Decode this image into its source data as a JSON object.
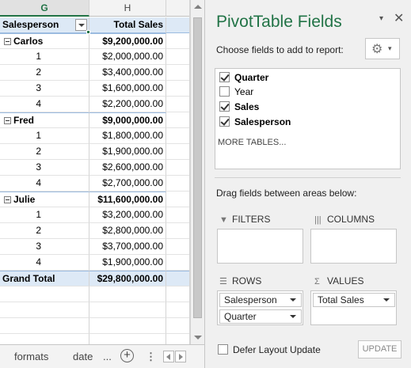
{
  "sheet": {
    "columns": [
      "G",
      "H"
    ],
    "headers": {
      "row_label": "Salesperson",
      "value_label": "Total Sales"
    },
    "groups": [
      {
        "name": "Carlos",
        "total": "$9,200,000.00",
        "items": [
          {
            "label": "1",
            "value": "$2,000,000.00"
          },
          {
            "label": "2",
            "value": "$3,400,000.00"
          },
          {
            "label": "3",
            "value": "$1,600,000.00"
          },
          {
            "label": "4",
            "value": "$2,200,000.00"
          }
        ]
      },
      {
        "name": "Fred",
        "total": "$9,000,000.00",
        "items": [
          {
            "label": "1",
            "value": "$1,800,000.00"
          },
          {
            "label": "2",
            "value": "$1,900,000.00"
          },
          {
            "label": "3",
            "value": "$2,600,000.00"
          },
          {
            "label": "4",
            "value": "$2,700,000.00"
          }
        ]
      },
      {
        "name": "Julie",
        "total": "$11,600,000.00",
        "items": [
          {
            "label": "1",
            "value": "$3,200,000.00"
          },
          {
            "label": "2",
            "value": "$2,800,000.00"
          },
          {
            "label": "3",
            "value": "$3,700,000.00"
          },
          {
            "label": "4",
            "value": "$1,900,000.00"
          }
        ]
      }
    ],
    "grand_total": {
      "label": "Grand Total",
      "value": "$29,800,000.00"
    }
  },
  "tabs": {
    "sheet1": "formats",
    "sheet2": "date",
    "more": "...",
    "add": "+",
    "separator": "⋮"
  },
  "pane": {
    "title": "PivotTable Fields",
    "close": "✕",
    "dropdown": "▾",
    "choose_label": "Choose fields to add to report:",
    "fields": [
      {
        "name": "Quarter",
        "checked": true
      },
      {
        "name": "Year",
        "checked": false
      },
      {
        "name": "Sales",
        "checked": true
      },
      {
        "name": "Salesperson",
        "checked": true
      }
    ],
    "more_tables": "MORE TABLES...",
    "drag_label": "Drag fields between areas below:",
    "areas": {
      "filters": "FILTERS",
      "columns": "COLUMNS",
      "rows": "ROWS",
      "values": "VALUES"
    },
    "rows_fields": [
      "Salesperson",
      "Quarter"
    ],
    "values_fields": [
      "Total Sales"
    ],
    "defer_label": "Defer Layout Update",
    "update_label": "UPDATE"
  },
  "colors": {
    "accent": "#217346",
    "header_fill": "#dde9f6"
  }
}
